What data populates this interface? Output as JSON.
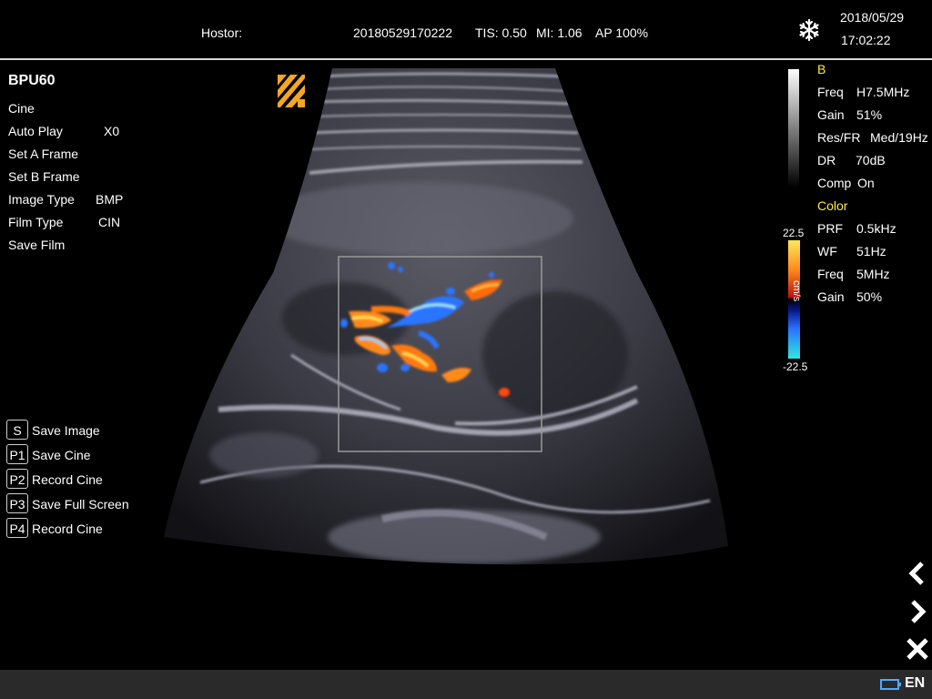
{
  "header": {
    "hostor_label": "Hostor:",
    "exam_id": "20180529170222",
    "tis": "TIS: 0.50",
    "mi": "MI: 1.06",
    "ap": "AP 100%",
    "date": "2018/05/29",
    "time": "17:02:22",
    "freeze_icon": "snowflake-icon"
  },
  "probe": "BPU60",
  "menu": {
    "items": [
      {
        "label": "Cine",
        "value": ""
      },
      {
        "label": "Auto Play",
        "value": "X0"
      },
      {
        "label": "Set A Frame",
        "value": ""
      },
      {
        "label": "Set B Frame",
        "value": ""
      },
      {
        "label": "Image Type",
        "value": "BMP"
      },
      {
        "label": "Film Type",
        "value": "CIN"
      },
      {
        "label": "Save Film",
        "value": ""
      }
    ]
  },
  "shortcuts": [
    {
      "key": "S",
      "label": "Save Image"
    },
    {
      "key": "P1",
      "label": "Save Cine"
    },
    {
      "key": "P2",
      "label": "Record Cine"
    },
    {
      "key": "P3",
      "label": "Save Full Screen"
    },
    {
      "key": "P4",
      "label": "Record Cine"
    }
  ],
  "bmode": {
    "title": "B",
    "params": [
      {
        "name": "Freq",
        "value": "H7.5MHz"
      },
      {
        "name": "Gain",
        "value": "51%"
      },
      {
        "name": "Res/FR",
        "value": "Med/19Hz"
      },
      {
        "name": "DR",
        "value": "70dB"
      },
      {
        "name": "Comp",
        "value": "On"
      }
    ]
  },
  "color": {
    "title": "Color",
    "params": [
      {
        "name": "PRF",
        "value": "0.5kHz"
      },
      {
        "name": "WF",
        "value": "51Hz"
      },
      {
        "name": "Freq",
        "value": "5MHz"
      },
      {
        "name": "Gain",
        "value": "50%"
      }
    ],
    "scale_max": "22.5",
    "scale_min": "-22.5",
    "scale_unit": "cm/s"
  },
  "status": {
    "language": "EN"
  },
  "colors": {
    "accent_yellow": "#ffe84a",
    "logo_orange": "#f5a623"
  }
}
